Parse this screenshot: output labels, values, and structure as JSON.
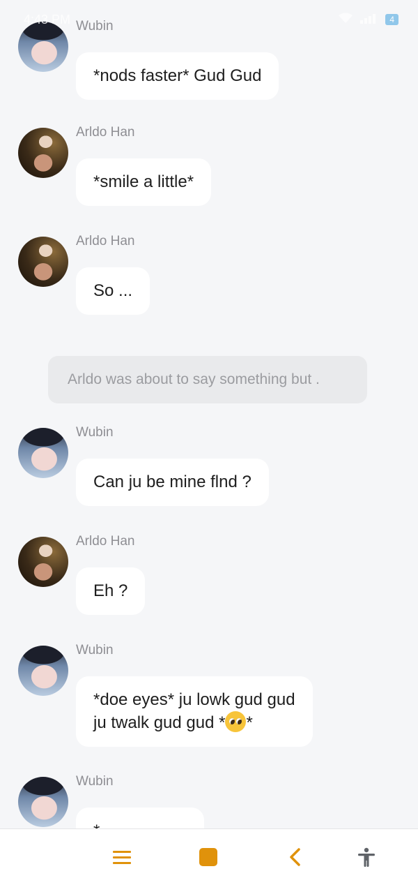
{
  "status_bar": {
    "time": "4:43 PM",
    "battery": "4"
  },
  "messages": [
    {
      "sender": "Wubin",
      "avatar": "wubin",
      "lines": [
        "*nods faster* Gud Gud"
      ]
    },
    {
      "sender": "Arldo Han",
      "avatar": "arldo",
      "lines": [
        "*smile a little*"
      ]
    },
    {
      "sender": "Arldo Han",
      "avatar": "arldo",
      "lines": [
        "So ..."
      ]
    },
    {
      "sender": "Wubin",
      "avatar": "wubin",
      "lines": [
        "Can ju be mine flnd ?"
      ]
    },
    {
      "sender": "Arldo Han",
      "avatar": "arldo",
      "lines": [
        "Eh ?"
      ]
    },
    {
      "sender": "Wubin",
      "avatar": "wubin",
      "lines": [
        "*doe eyes* ju lowk gud gud",
        "ju twalk gud gud *",
        "*"
      ],
      "emoji": "pleading-face"
    },
    {
      "sender": "Wubin",
      "avatar": "wubin",
      "lines": [
        "*"
      ]
    }
  ],
  "narration": "Arldo was about to say something but .",
  "nav": {
    "items": [
      "menu-icon",
      "home-square-icon",
      "back-chevron-icon",
      "accessibility-icon"
    ],
    "accent": "#e0920b",
    "muted": "#5f6368"
  }
}
